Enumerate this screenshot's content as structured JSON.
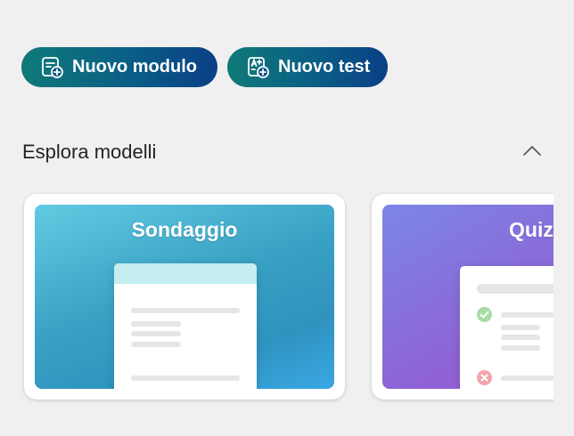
{
  "toolbar": {
    "new_form_label": "Nuovo modulo",
    "new_quiz_label": "Nuovo test"
  },
  "templates": {
    "title": "Esplora modelli",
    "cards": [
      {
        "title": "Sondaggio"
      },
      {
        "title": "Quiz"
      }
    ]
  },
  "colors": {
    "button_gradient_start": "#0f7a78",
    "button_gradient_end": "#0b3f86",
    "survey_accent": "#3aa2c4",
    "quiz_accent": "#8e63d6",
    "background": "#f0f0f0"
  },
  "icons": {
    "new_form": "form-add-icon",
    "new_quiz": "quiz-add-icon",
    "collapse": "chevron-up-icon"
  }
}
